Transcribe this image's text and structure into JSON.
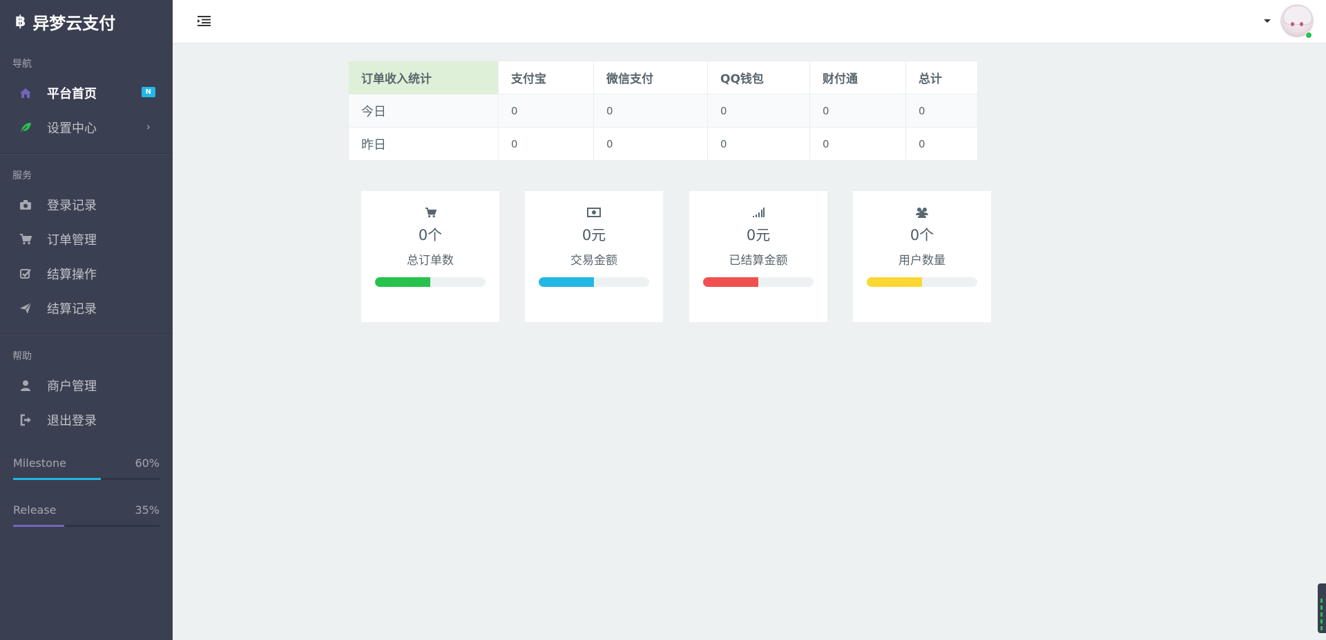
{
  "brand": {
    "title": "异梦云支付",
    "logo_glyph": "฿"
  },
  "sidebar": {
    "sections": [
      {
        "header": "导航"
      },
      {
        "header": "服务"
      },
      {
        "header": "帮助"
      }
    ],
    "nav": {
      "home": {
        "label": "平台首页",
        "badge": "N"
      },
      "settings": {
        "label": "设置中心"
      }
    },
    "service": {
      "login_log": {
        "label": "登录记录"
      },
      "orders": {
        "label": "订单管理"
      },
      "settle_op": {
        "label": "结算操作"
      },
      "settle_log": {
        "label": "结算记录"
      }
    },
    "help": {
      "merchant": {
        "label": "商户管理"
      },
      "logout": {
        "label": "退出登录"
      }
    },
    "progress": [
      {
        "label": "Milestone",
        "value_text": "60%",
        "value": 0.6,
        "color": "#23b7e5"
      },
      {
        "label": "Release",
        "value_text": "35%",
        "value": 0.35,
        "color": "#7266ba"
      }
    ]
  },
  "table": {
    "headers": [
      "订单收入统计",
      "支付宝",
      "微信支付",
      "QQ钱包",
      "财付通",
      "总计"
    ],
    "rows": [
      [
        "今日",
        "0",
        "0",
        "0",
        "0",
        "0"
      ],
      [
        "昨日",
        "0",
        "0",
        "0",
        "0",
        "0"
      ]
    ]
  },
  "cards": [
    {
      "icon": "cart-icon",
      "value": "0个",
      "label": "总订单数",
      "color": "#27c24c",
      "fill": 0.5
    },
    {
      "icon": "money-icon",
      "value": "0元",
      "label": "交易金额",
      "color": "#23b7e5",
      "fill": 0.5
    },
    {
      "icon": "signal-icon",
      "value": "0元",
      "label": "已结算金额",
      "color": "#f05050",
      "fill": 0.5
    },
    {
      "icon": "users-icon",
      "value": "0个",
      "label": "用户数量",
      "color": "#fad733",
      "fill": 0.5
    }
  ]
}
